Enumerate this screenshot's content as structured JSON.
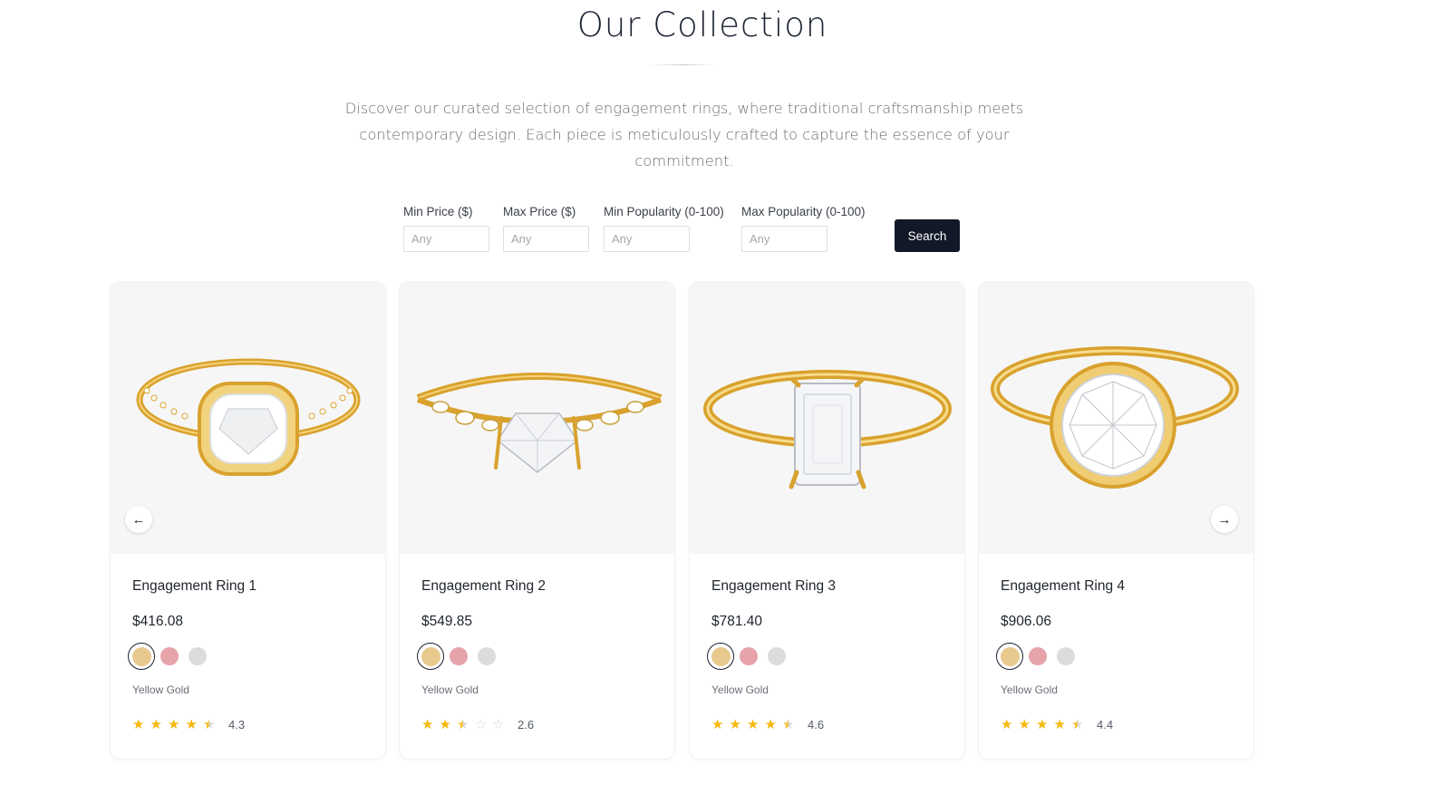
{
  "page": {
    "title": "Our Collection",
    "subtitle_line1": "Discover our curated selection of engagement rings, where traditional craftsmanship meets",
    "subtitle_line2": "contemporary design. Each piece is meticulously crafted to capture the essence of your commitment."
  },
  "filters": {
    "min_price": {
      "label": "Min Price ($)",
      "placeholder": "Any"
    },
    "max_price": {
      "label": "Max Price ($)",
      "placeholder": "Any"
    },
    "min_popularity": {
      "label": "Min Popularity (0-100)",
      "placeholder": "Any"
    },
    "max_popularity": {
      "label": "Max Popularity (0-100)",
      "placeholder": "Any"
    },
    "search_label": "Search"
  },
  "carousel": {
    "prev_icon": "arrow-left-icon",
    "next_icon": "arrow-right-icon"
  },
  "colors": {
    "yellow_gold": "#e8c98e",
    "rose_gold": "#e6a3aa",
    "white_gold": "#dcdcdc",
    "star_filled": "#f5b80f",
    "star_empty": "#d9d9d9",
    "accent_dark": "#111827"
  },
  "products": [
    {
      "name": "Engagement Ring 1",
      "price": "$416.08",
      "metal": "Yellow Gold",
      "rating": 4.3,
      "rating_text": "4.3"
    },
    {
      "name": "Engagement Ring 2",
      "price": "$549.85",
      "metal": "Yellow Gold",
      "rating": 2.6,
      "rating_text": "2.6"
    },
    {
      "name": "Engagement Ring 3",
      "price": "$781.40",
      "metal": "Yellow Gold",
      "rating": 4.6,
      "rating_text": "4.6"
    },
    {
      "name": "Engagement Ring 4",
      "price": "$906.06",
      "metal": "Yellow Gold",
      "rating": 4.4,
      "rating_text": "4.4"
    }
  ]
}
